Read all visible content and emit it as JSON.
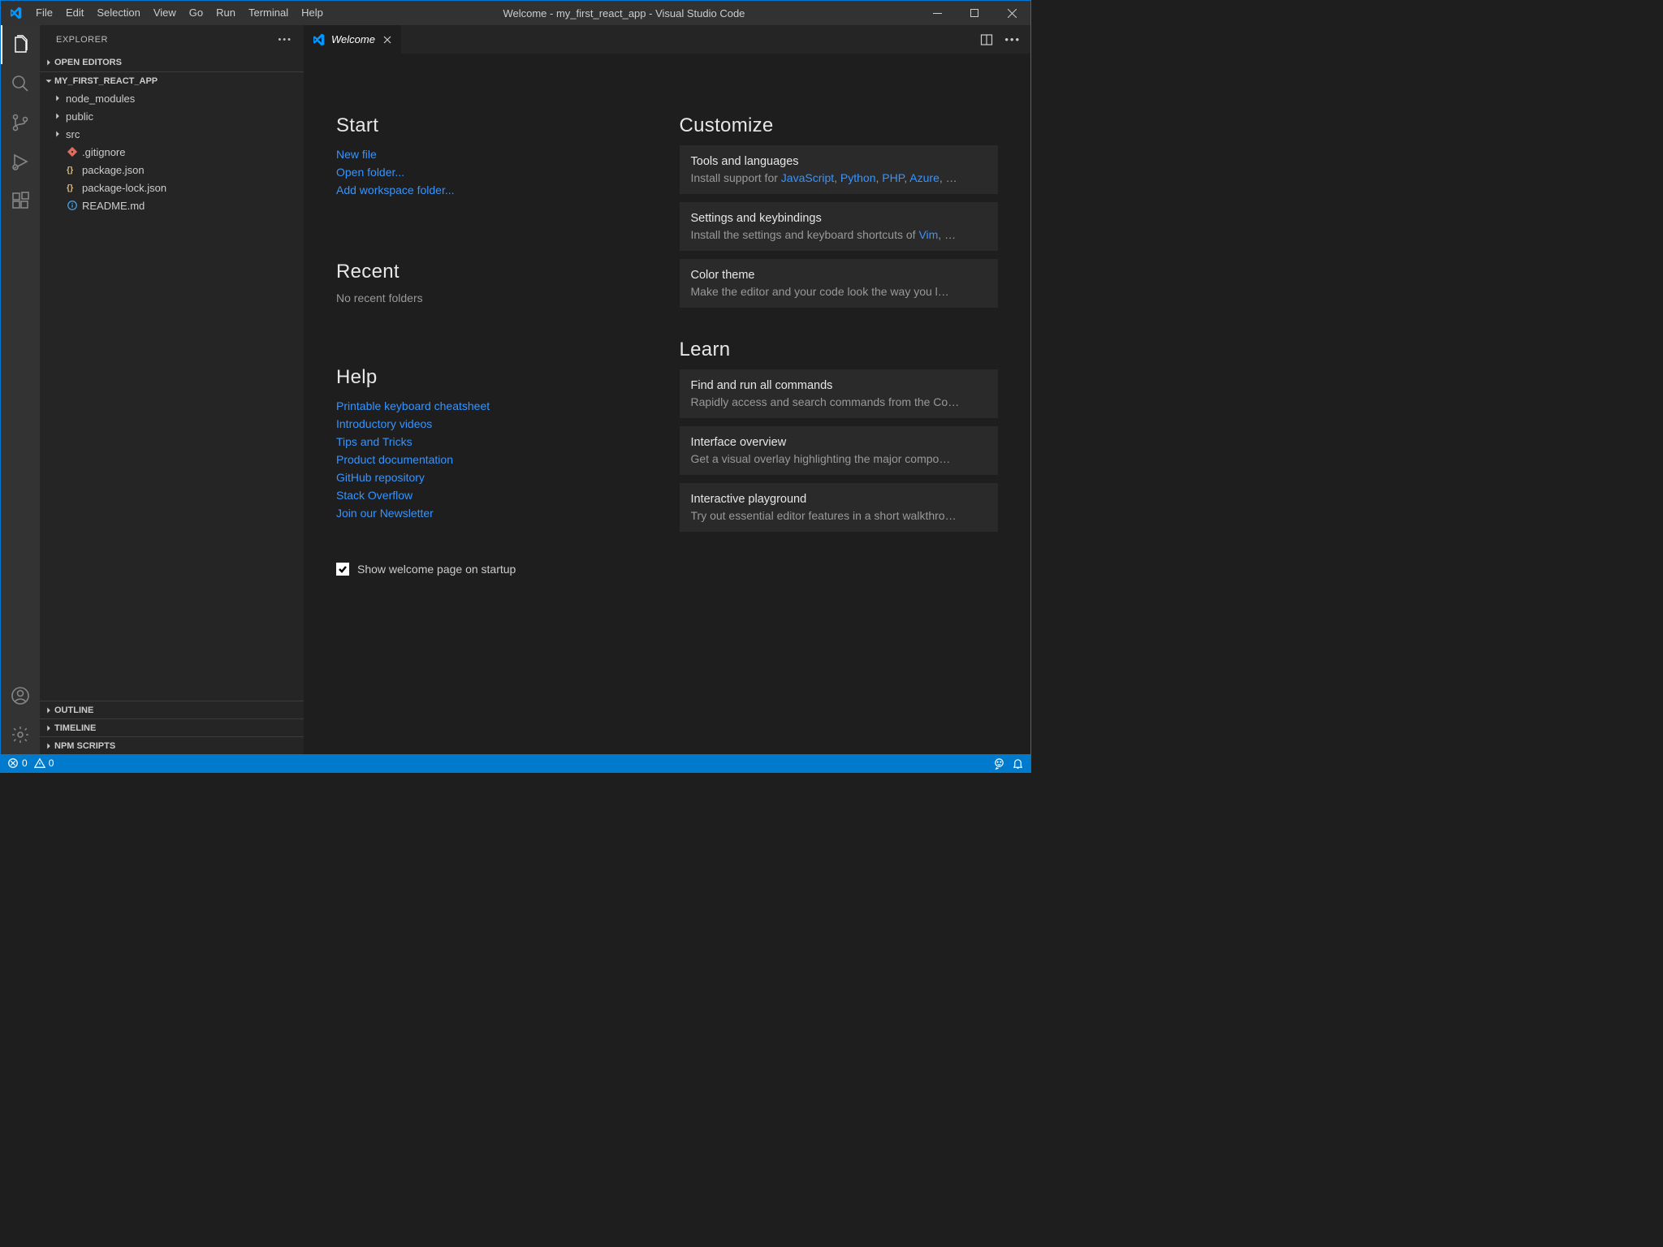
{
  "window": {
    "title": "Welcome - my_first_react_app - Visual Studio Code"
  },
  "menu": [
    "File",
    "Edit",
    "Selection",
    "View",
    "Go",
    "Run",
    "Terminal",
    "Help"
  ],
  "sidebar": {
    "title": "EXPLORER",
    "sections": {
      "open_editors": "OPEN EDITORS",
      "folder": "MY_FIRST_REACT_APP",
      "outline": "OUTLINE",
      "timeline": "TIMELINE",
      "npm": "NPM SCRIPTS"
    },
    "tree": [
      {
        "type": "folder",
        "label": "node_modules"
      },
      {
        "type": "folder",
        "label": "public"
      },
      {
        "type": "folder",
        "label": "src"
      },
      {
        "type": "gitignore",
        "label": ".gitignore"
      },
      {
        "type": "json",
        "label": "package.json"
      },
      {
        "type": "json",
        "label": "package-lock.json"
      },
      {
        "type": "readme",
        "label": "README.md"
      }
    ]
  },
  "tab": {
    "label": "Welcome"
  },
  "welcome": {
    "start": {
      "heading": "Start",
      "links": [
        "New file",
        "Open folder...",
        "Add workspace folder..."
      ]
    },
    "recent": {
      "heading": "Recent",
      "empty": "No recent folders"
    },
    "help": {
      "heading": "Help",
      "links": [
        "Printable keyboard cheatsheet",
        "Introductory videos",
        "Tips and Tricks",
        "Product documentation",
        "GitHub repository",
        "Stack Overflow",
        "Join our Newsletter"
      ]
    },
    "show_on_startup": "Show welcome page on startup",
    "customize": {
      "heading": "Customize",
      "cards": [
        {
          "title": "Tools and languages",
          "desc_prefix": "Install support for ",
          "links": [
            "JavaScript",
            "Python",
            "PHP",
            "Azure"
          ],
          "suffix": ", …"
        },
        {
          "title": "Settings and keybindings",
          "desc_prefix": "Install the settings and keyboard shortcuts of ",
          "links": [
            "Vim"
          ],
          "suffix": ", …"
        },
        {
          "title": "Color theme",
          "desc": "Make the editor and your code look the way you l…"
        }
      ]
    },
    "learn": {
      "heading": "Learn",
      "cards": [
        {
          "title": "Find and run all commands",
          "desc": "Rapidly access and search commands from the Co…"
        },
        {
          "title": "Interface overview",
          "desc": "Get a visual overlay highlighting the major compo…"
        },
        {
          "title": "Interactive playground",
          "desc": "Try out essential editor features in a short walkthro…"
        }
      ]
    }
  },
  "statusbar": {
    "errors": "0",
    "warnings": "0"
  }
}
